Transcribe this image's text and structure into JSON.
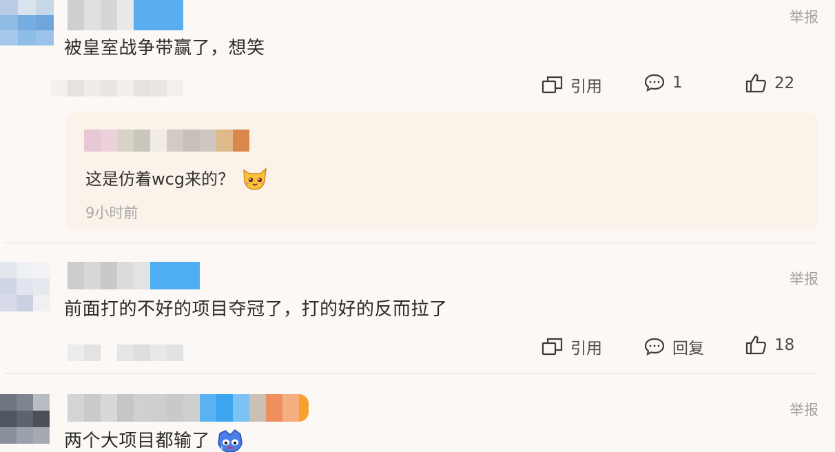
{
  "comments": [
    {
      "text": "被皇室战争带赢了，想笑",
      "report": "举报",
      "actions": {
        "quote": "引用",
        "reply": "1",
        "likes": "22"
      },
      "reply": {
        "text": "这是仿着wcg来的？",
        "emoji": "cat-emoji",
        "time": "9小时前"
      }
    },
    {
      "text": "前面打的不好的项目夺冠了，打的好的反而拉了",
      "report": "举报",
      "actions": {
        "quote": "引用",
        "reply": "回复",
        "likes": "18"
      }
    },
    {
      "text": "两个大项目都输了",
      "report": "举报",
      "emoji": "crying-emoji"
    }
  ],
  "colors": {
    "background": "#fcf8f5",
    "reply_background": "#fbf2e9",
    "muted": "#a3a3a3"
  }
}
